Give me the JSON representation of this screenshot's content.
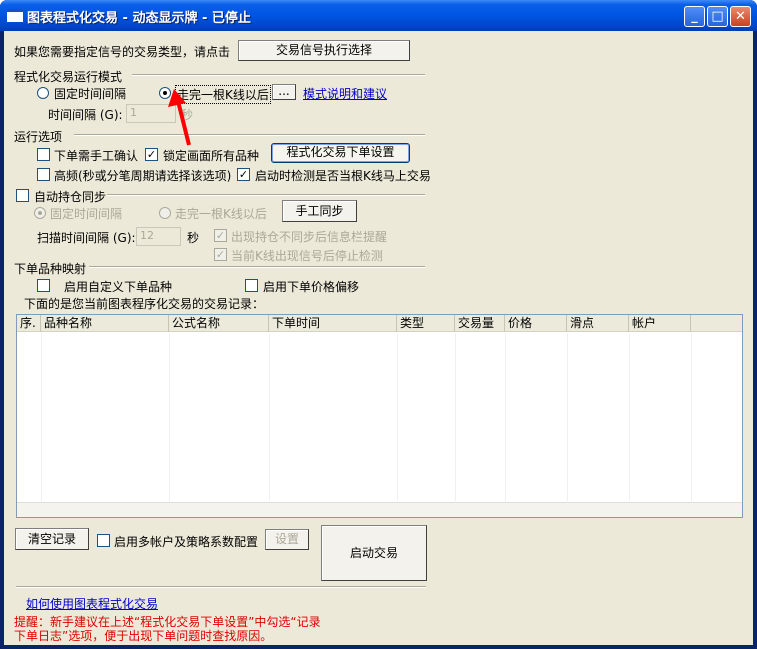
{
  "window": {
    "title": "图表程式化交易 - 动态显示牌 - 已停止",
    "controls": {
      "minimize": "_",
      "maximize": "□",
      "close": "✕"
    }
  },
  "signal": {
    "prompt": "如果您需要指定信号的交易类型，请点击",
    "button": "交易信号执行选择"
  },
  "run_mode": {
    "title": "程式化交易运行模式",
    "fixed_interval": "固定时间间隔",
    "after_kline": "走完一根K线以后",
    "ellipsis_button": "...",
    "help_link": "模式说明和建议",
    "interval_label": "时间间隔",
    "interval_hotkey": "(G):",
    "interval_value": "1",
    "interval_unit": "秒"
  },
  "run_options": {
    "title": "运行选项",
    "manual_confirm": "下单需手工确认",
    "lock_all": "锁定画面所有品种",
    "order_settings_button": "程式化交易下单设置",
    "high_freq": "高频(秒或分笔周期请选择该选项)",
    "check_on_start": "启动时检测是否当根K线马上交易"
  },
  "position_sync": {
    "title": "自动持仓同步",
    "fixed_interval": "固定时间间隔",
    "after_kline": "走完一根K线以后",
    "manual_sync_button": "手工同步",
    "scan_label": "扫描时间间隔",
    "scan_hotkey": "(G):",
    "scan_value": "12",
    "scan_unit": "秒",
    "alert_mismatch": "出现持仓不同步后信息栏提醒",
    "stop_on_signal": "当前K线出现信号后停止检测"
  },
  "mapping": {
    "title": "下单品种映射",
    "custom_symbol": "启用自定义下单品种",
    "price_offset": "启用下单价格偏移"
  },
  "records": {
    "caption": "下面的是您当前图表程序化交易的交易记录：",
    "columns": [
      "序.",
      "品种名称",
      "公式名称",
      "下单时间",
      "类型",
      "交易量",
      "价格",
      "滑点",
      "帐户"
    ]
  },
  "bottom": {
    "clear_button": "清空记录",
    "multi_account": "启用多帐户及策略系数配置",
    "settings_button": "设置",
    "start_button": "启动交易",
    "howto_link": "如何使用图表程式化交易",
    "tip_line1": "提醒：新手建议在上述“程式化交易下单设置”中勾选“记录",
    "tip_line2": "下单日志”选项，便于出现下单问题时查找原因。"
  }
}
